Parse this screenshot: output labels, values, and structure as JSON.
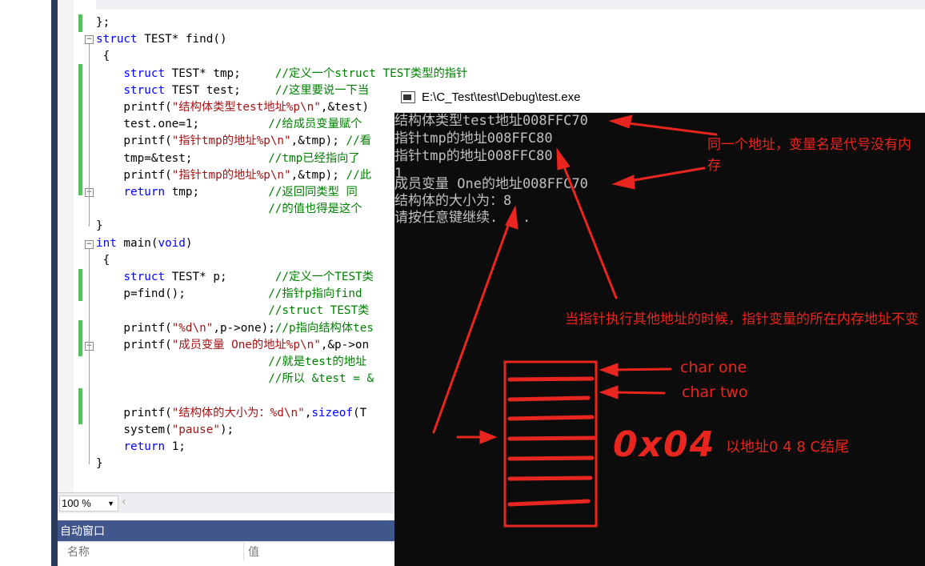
{
  "editor": {
    "lines": [
      [
        {
          "t": "};",
          "c": ""
        }
      ],
      [
        {
          "t": "struct",
          "c": "kw"
        },
        {
          "t": " TEST* find()",
          "c": ""
        }
      ],
      [
        {
          "t": " {",
          "c": ""
        }
      ],
      [
        {
          "t": "    ",
          "c": ""
        },
        {
          "t": "struct",
          "c": "kw"
        },
        {
          "t": " TEST* tmp;     ",
          "c": ""
        },
        {
          "t": "//定义一个struct TEST类型的指针",
          "c": "cm"
        }
      ],
      [
        {
          "t": "    ",
          "c": ""
        },
        {
          "t": "struct",
          "c": "kw"
        },
        {
          "t": " TEST test;     ",
          "c": ""
        },
        {
          "t": "//这里要说一下当",
          "c": "cm"
        }
      ],
      [
        {
          "t": "    printf(",
          "c": ""
        },
        {
          "t": "\"结构体类型test地址%p\\n\"",
          "c": "str"
        },
        {
          "t": ",&test)",
          "c": ""
        }
      ],
      [
        {
          "t": "    test.one=1;          ",
          "c": ""
        },
        {
          "t": "//给成员变量赋个",
          "c": "cm"
        }
      ],
      [
        {
          "t": "    printf(",
          "c": ""
        },
        {
          "t": "\"指针tmp的地址%p\\n\"",
          "c": "str"
        },
        {
          "t": ",&tmp); ",
          "c": ""
        },
        {
          "t": "//看",
          "c": "cm"
        }
      ],
      [
        {
          "t": "    tmp=&test;           ",
          "c": ""
        },
        {
          "t": "//tmp已经指向了",
          "c": "cm"
        }
      ],
      [
        {
          "t": "    printf(",
          "c": ""
        },
        {
          "t": "\"指针tmp的地址%p\\n\"",
          "c": "str"
        },
        {
          "t": ",&tmp); ",
          "c": ""
        },
        {
          "t": "//此",
          "c": "cm"
        }
      ],
      [
        {
          "t": "    ",
          "c": ""
        },
        {
          "t": "return",
          "c": "kw"
        },
        {
          "t": " tmp;          ",
          "c": ""
        },
        {
          "t": "//返回同类型 同",
          "c": "cm"
        }
      ],
      [
        {
          "t": "                         ",
          "c": ""
        },
        {
          "t": "//的值也得是这个",
          "c": "cm"
        }
      ],
      [
        {
          "t": "}",
          "c": ""
        }
      ],
      [
        {
          "t": "int",
          "c": "kw"
        },
        {
          "t": " main(",
          "c": ""
        },
        {
          "t": "void",
          "c": "kw"
        },
        {
          "t": ")",
          "c": ""
        }
      ],
      [
        {
          "t": " {",
          "c": ""
        }
      ],
      [
        {
          "t": "    ",
          "c": ""
        },
        {
          "t": "struct",
          "c": "kw"
        },
        {
          "t": " TEST* p;       ",
          "c": ""
        },
        {
          "t": "//定义一个TEST类",
          "c": "cm"
        }
      ],
      [
        {
          "t": "    p=find();            ",
          "c": ""
        },
        {
          "t": "//指针p指向find",
          "c": "cm"
        }
      ],
      [
        {
          "t": "                         ",
          "c": ""
        },
        {
          "t": "//struct TEST类",
          "c": "cm"
        }
      ],
      [
        {
          "t": "    printf(",
          "c": ""
        },
        {
          "t": "\"%d\\n\"",
          "c": "str"
        },
        {
          "t": ",p->one);",
          "c": ""
        },
        {
          "t": "//p指向结构体tes",
          "c": "cm"
        }
      ],
      [
        {
          "t": "    printf(",
          "c": ""
        },
        {
          "t": "\"成员变量 One的地址%p\\n\"",
          "c": "str"
        },
        {
          "t": ",&p->on",
          "c": ""
        }
      ],
      [
        {
          "t": "                         ",
          "c": ""
        },
        {
          "t": "//就是test的地址",
          "c": "cm"
        }
      ],
      [
        {
          "t": "                         ",
          "c": ""
        },
        {
          "t": "//所以 &test = &",
          "c": "cm"
        }
      ],
      [
        {
          "t": "",
          "c": ""
        }
      ],
      [
        {
          "t": "    printf(",
          "c": ""
        },
        {
          "t": "\"结构体的大小为：%d\\n\"",
          "c": "str"
        },
        {
          "t": ",",
          "c": ""
        },
        {
          "t": "sizeof",
          "c": "kw"
        },
        {
          "t": "(T",
          "c": ""
        }
      ],
      [
        {
          "t": "    system(",
          "c": ""
        },
        {
          "t": "\"pause\"",
          "c": "str"
        },
        {
          "t": ");",
          "c": ""
        }
      ],
      [
        {
          "t": "    ",
          "c": ""
        },
        {
          "t": "return",
          "c": "kw"
        },
        {
          "t": " 1;",
          "c": ""
        }
      ],
      [
        {
          "t": "}",
          "c": ""
        }
      ]
    ],
    "zoom": "100 %"
  },
  "auto_window": {
    "title": "自动窗口",
    "col_name": "名称",
    "col_value": "值"
  },
  "console": {
    "title": "E:\\C_Test\\test\\Debug\\test.exe",
    "lines": [
      "结构体类型test地址008FFC70",
      "指针tmp的地址008FFC80",
      "指针tmp的地址008FFC80",
      "1",
      "成员变量 One的地址008FFC70",
      "结构体的大小为：8",
      "请按任意键继续. . ."
    ]
  },
  "annotations": {
    "same_address": "同一个地址，变量名是代号没有内存",
    "pointer_note": "当指针执行其他地址的时候，指针变量的所在内存地址不变",
    "char_one": "char one",
    "char_two": "char two",
    "hex_label": "0x04",
    "ending_note": "以地址0 4 8 C结尾"
  },
  "colors": {
    "annotation_red": "#e8261f",
    "keyword": "#0000ff",
    "string": "#a31515",
    "comment": "#008000",
    "console_bg": "#0c0c0c",
    "console_text": "#c0c0c0"
  }
}
